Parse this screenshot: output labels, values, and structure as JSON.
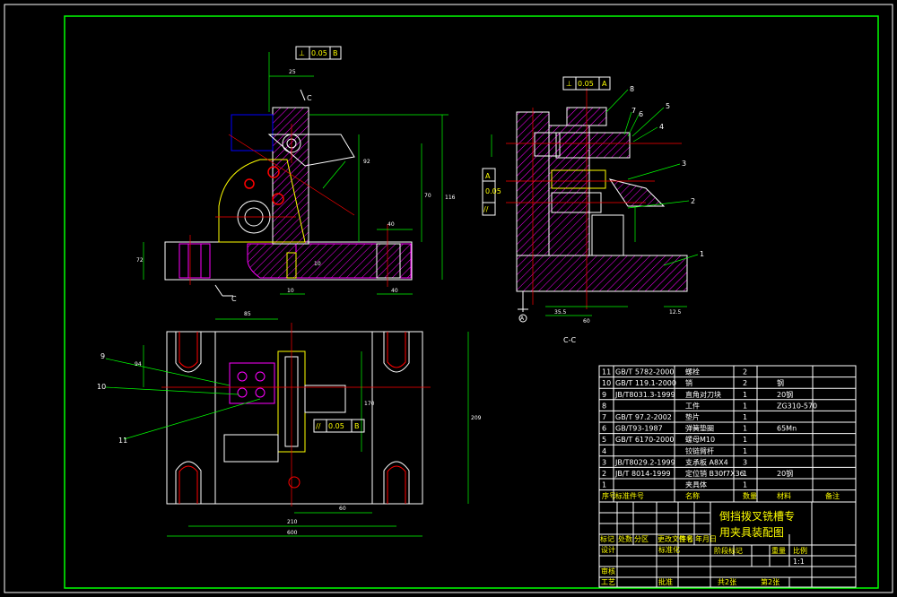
{
  "drawing": {
    "section_label": "C-C",
    "datum_label": "A",
    "tolerances": [
      {
        "sym": "⊥",
        "value": "0.05",
        "datum": "B"
      },
      {
        "sym": "⊥",
        "value": "0.05",
        "datum": "A"
      },
      {
        "sym": "//",
        "value": "0.05",
        "datum": "A"
      },
      {
        "sym": "//",
        "value": "0.05",
        "datum": "B"
      }
    ],
    "balloons_side": [
      "8",
      "7",
      "6",
      "5",
      "4",
      "3",
      "2",
      "1"
    ],
    "balloons_plan": [
      "9",
      "10",
      "11"
    ],
    "section_mark": "C",
    "dims_front": [
      "25",
      "92",
      "70",
      "116",
      "72",
      "40",
      "10",
      "10",
      "40"
    ],
    "dims_side": [
      "35.5",
      "60",
      "12.5"
    ],
    "dims_plan": [
      "85",
      "94",
      "170",
      "60",
      "210",
      "600",
      "209"
    ]
  },
  "bom": {
    "rows": [
      {
        "no": "11",
        "std": "GB/T 5782-2000",
        "name": "螺栓",
        "qty": "2",
        "mat": "",
        "note": ""
      },
      {
        "no": "10",
        "std": "GB/T 119.1-2000",
        "name": "销",
        "qty": "2",
        "mat": "钢",
        "note": ""
      },
      {
        "no": "9",
        "std": "JB/T8031.3-1999",
        "name": "直角对刀块",
        "qty": "1",
        "mat": "20钢",
        "note": ""
      },
      {
        "no": "8",
        "std": "",
        "name": "工件",
        "qty": "1",
        "mat": "ZG310-570",
        "note": ""
      },
      {
        "no": "7",
        "std": "GB/T 97.2-2002",
        "name": "垫片",
        "qty": "1",
        "mat": "",
        "note": ""
      },
      {
        "no": "6",
        "std": "GB/T93-1987",
        "name": "弹簧垫圈",
        "qty": "1",
        "mat": "65Mn",
        "note": ""
      },
      {
        "no": "5",
        "std": "GB/T 6170-2000",
        "name": "螺母M10",
        "qty": "1",
        "mat": "",
        "note": ""
      },
      {
        "no": "4",
        "std": "",
        "name": "铰链臂杆",
        "qty": "1",
        "mat": "",
        "note": ""
      },
      {
        "no": "3",
        "std": "JB/T8029.2-1999",
        "name": "支承板 A8X4",
        "qty": "3",
        "mat": "",
        "note": ""
      },
      {
        "no": "2",
        "std": "JB/T 8014-1999",
        "name": "定位销 B30f7X36",
        "qty": "1",
        "mat": "20钢",
        "note": ""
      },
      {
        "no": "1",
        "std": "",
        "name": "夹具体",
        "qty": "1",
        "mat": "",
        "note": ""
      }
    ],
    "header": {
      "no": "序号",
      "std": "标准件号",
      "name": "名称",
      "qty": "数量",
      "mat": "材料",
      "note": "备注"
    }
  },
  "title_block": {
    "title_line1": "倒挡拨叉铣槽专",
    "title_line2": "用夹具装配图",
    "row_labels": [
      "标记",
      "处数",
      "分区",
      "更改文件号",
      "签名",
      "年月日"
    ],
    "design": "设计",
    "standardize": "标准化",
    "review": "审核",
    "process": "工艺",
    "approve": "批准",
    "stage": "阶段标记",
    "weight": "重量",
    "scale_label": "比例",
    "scale_value": "1:1",
    "sheets": "共2张",
    "sheet_no": "第2张"
  },
  "colors": {
    "border": "#00ff00",
    "outline": "#ffffff",
    "hatch": "#ff00ff",
    "dim": "#00ff00",
    "center": "#ff0000",
    "blue": "#0000ff",
    "yellow": "#ffff00",
    "cyan": "#00ffff"
  }
}
